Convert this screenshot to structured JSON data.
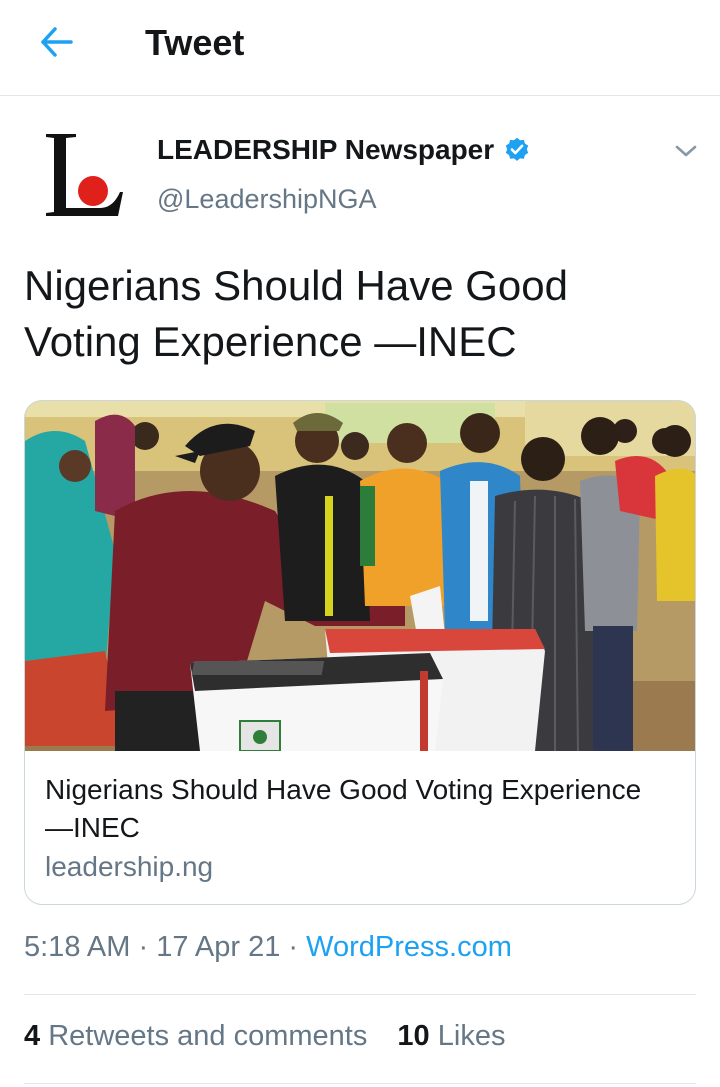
{
  "header": {
    "title": "Tweet",
    "back_icon": "arrow-left-icon",
    "accent": "#1da1f2"
  },
  "author": {
    "display_name": "LEADERSHIP Newspaper",
    "handle": "@LeadershipNGA",
    "verified_icon": "verified-badge-icon",
    "avatar_logo": "leadership-logo"
  },
  "menu_icon": "chevron-down-icon",
  "tweet": {
    "text": "Nigerians Should Have Good Voting Experience —INEC"
  },
  "card": {
    "image": "photo-voters-casting-ballots",
    "title": "Nigerians Should Have Good Voting Experience —INEC",
    "domain": "leadership.ng"
  },
  "meta": {
    "time": "5:18 AM",
    "separator": "·",
    "date": "17 Apr 21",
    "source": "WordPress.com"
  },
  "stats": {
    "retweets_count": "4",
    "retweets_label": "Retweets and comments",
    "likes_count": "10",
    "likes_label": "Likes"
  },
  "colors": {
    "text_primary": "#14171a",
    "text_secondary": "#657786",
    "link": "#1da1f2",
    "border": "#e1e8ed",
    "logo_red": "#e0201b"
  }
}
